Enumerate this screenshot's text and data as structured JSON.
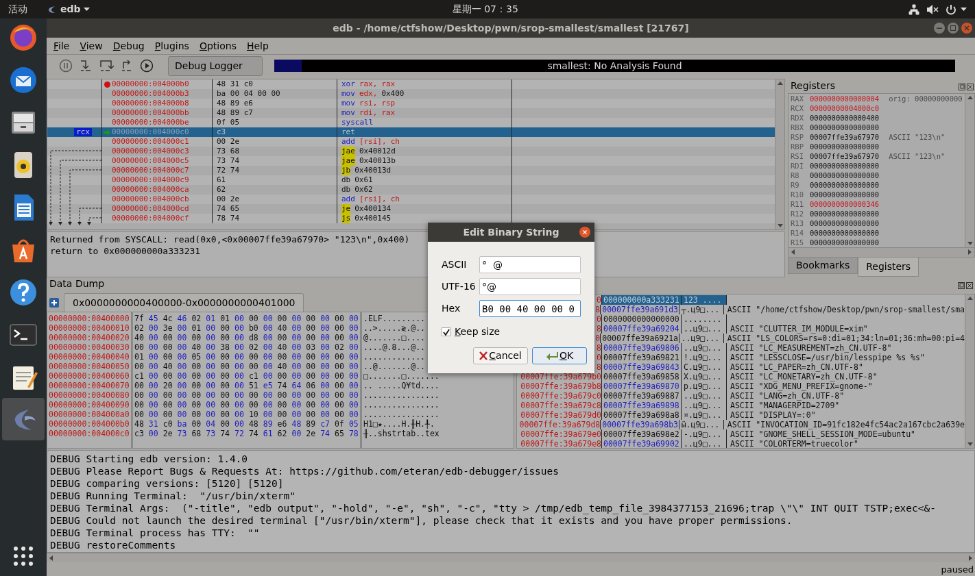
{
  "top_bar": {
    "activities": "活动",
    "app_name": "edb",
    "clock": "星期一 07：35"
  },
  "window": {
    "title": "edb - /home/ctfshow/Desktop/pwn/srop-smallest/smallest [21767]"
  },
  "menu": [
    "File",
    "View",
    "Debug",
    "Plugins",
    "Options",
    "Help"
  ],
  "toolbar": {
    "logger_button": "Debug Logger",
    "analysis": {
      "label": "smallest: No Analysis Found",
      "level": 0.04
    }
  },
  "disassembly": [
    {
      "address": "00000000:004000b0",
      "bytes": "48 31 c0",
      "mnemonic": "xor",
      "kind": "instruction",
      "operands": [
        {
          "text": "rax,",
          "kind": "register"
        },
        {
          "text": "rax",
          "kind": "register"
        }
      ],
      "breakpoint": true,
      "selected": false
    },
    {
      "address": "00000000:004000b3",
      "bytes": "ba 00 04 00 00",
      "mnemonic": "mov",
      "kind": "instruction",
      "operands": [
        {
          "text": "edx,",
          "kind": "register"
        },
        {
          "text": "0x400",
          "kind": "number"
        }
      ],
      "breakpoint": false,
      "selected": false
    },
    {
      "address": "00000000:004000b8",
      "bytes": "48 89 e6",
      "mnemonic": "mov",
      "kind": "instruction",
      "operands": [
        {
          "text": "rsi,",
          "kind": "register"
        },
        {
          "text": "rsp",
          "kind": "register"
        }
      ],
      "breakpoint": false,
      "selected": false
    },
    {
      "address": "00000000:004000bb",
      "bytes": "48 89 c7",
      "mnemonic": "mov",
      "kind": "instruction",
      "operands": [
        {
          "text": "rdi,",
          "kind": "register"
        },
        {
          "text": "rax",
          "kind": "register"
        }
      ],
      "breakpoint": false,
      "selected": false
    },
    {
      "address": "00000000:004000be",
      "bytes": "0f 05",
      "mnemonic": "syscall",
      "kind": "instruction",
      "breakpoint": false,
      "selected": false
    },
    {
      "address": "00000000:004000c0",
      "bytes": "c3",
      "mnemonic": "ret",
      "kind": "instruction",
      "breakpoint": false,
      "selected": true,
      "register_label": "rcx"
    },
    {
      "address": "00000000:004000c1",
      "bytes": "00 2e",
      "mnemonic": "add",
      "kind": "instruction",
      "operands": [
        {
          "text": "[rsi],",
          "kind": "register"
        },
        {
          "text": "ch",
          "kind": "register"
        }
      ],
      "breakpoint": false,
      "selected": false
    },
    {
      "address": "00000000:004000c3",
      "bytes": "73 68",
      "mnemonic": "jae",
      "kind": "jump",
      "operands": [
        {
          "text": "0x40012d",
          "kind": "number"
        }
      ],
      "breakpoint": false,
      "selected": false
    },
    {
      "address": "00000000:004000c5",
      "bytes": "73 74",
      "mnemonic": "jae",
      "kind": "jump",
      "operands": [
        {
          "text": "0x40013b",
          "kind": "number"
        }
      ],
      "breakpoint": false,
      "selected": false
    },
    {
      "address": "00000000:004000c7",
      "bytes": "72 74",
      "mnemonic": "jb",
      "kind": "jump",
      "operands": [
        {
          "text": "0x40013d",
          "kind": "number"
        }
      ],
      "breakpoint": false,
      "selected": false
    },
    {
      "address": "00000000:004000c9",
      "bytes": "61",
      "mnemonic": "db",
      "kind": "data",
      "operands": [
        {
          "text": "0x61",
          "kind": "number"
        }
      ],
      "breakpoint": false,
      "selected": false
    },
    {
      "address": "00000000:004000ca",
      "bytes": "62",
      "mnemonic": "db",
      "kind": "data",
      "operands": [
        {
          "text": "0x62",
          "kind": "number"
        }
      ],
      "breakpoint": false,
      "selected": false
    },
    {
      "address": "00000000:004000cb",
      "bytes": "00 2e",
      "mnemonic": "add",
      "kind": "instruction",
      "operands": [
        {
          "text": "[rsi],",
          "kind": "register"
        },
        {
          "text": "ch",
          "kind": "register"
        }
      ],
      "breakpoint": false,
      "selected": false
    },
    {
      "address": "00000000:004000cd",
      "bytes": "74 65",
      "mnemonic": "je",
      "kind": "jump",
      "operands": [
        {
          "text": "0x400134",
          "kind": "number"
        }
      ],
      "breakpoint": false,
      "selected": false
    },
    {
      "address": "00000000:004000cf",
      "bytes": "78 74",
      "mnemonic": "js",
      "kind": "jump",
      "operands": [
        {
          "text": "0x400145",
          "kind": "number"
        }
      ],
      "breakpoint": false,
      "selected": false
    }
  ],
  "output": [
    "Returned from SYSCALL: read(0x0,<0x00007ffe39a67970> \"123\\n\",0x400)",
    "return to 0x000000000a333231"
  ],
  "registers": {
    "title": "Registers",
    "rows": [
      {
        "name": "RAX",
        "value": "0000000000000004",
        "changed": true,
        "comment": "orig: 00000000000"
      },
      {
        "name": "RCX",
        "value": "00000000004000c0",
        "changed": true
      },
      {
        "name": "RDX",
        "value": "0000000000000400",
        "changed": false
      },
      {
        "name": "RBX",
        "value": "0000000000000000",
        "changed": false
      },
      {
        "name": "RSP",
        "value": "00007ffe39a67970",
        "changed": false,
        "comment": "ASCII \"123\\n\""
      },
      {
        "name": "RBP",
        "value": "0000000000000000",
        "changed": false
      },
      {
        "name": "RSI",
        "value": "00007ffe39a67970",
        "changed": false,
        "comment": "ASCII \"123\\n\""
      },
      {
        "name": "RDI",
        "value": "0000000000000000",
        "changed": false
      },
      {
        "name": "R8",
        "value": "0000000000000000",
        "changed": false
      },
      {
        "name": "R9",
        "value": "0000000000000000",
        "changed": false
      },
      {
        "name": "R10",
        "value": "0000000000000000",
        "changed": false
      },
      {
        "name": "R11",
        "value": "0000000000000346",
        "changed": true
      },
      {
        "name": "R12",
        "value": "0000000000000000",
        "changed": false
      },
      {
        "name": "R13",
        "value": "0000000000000000",
        "changed": false
      },
      {
        "name": "R14",
        "value": "0000000000000000",
        "changed": false
      },
      {
        "name": "R15",
        "value": "0000000000000000",
        "changed": false
      }
    ],
    "tabs": [
      {
        "label": "Bookmarks",
        "selected": false
      },
      {
        "label": "Registers",
        "selected": true
      }
    ]
  },
  "data_dump": {
    "title": "Data Dump",
    "tab": "0x0000000000400000-0x0000000000401000",
    "rows": [
      {
        "address": "00000000:00400000",
        "bytes": [
          "7f",
          "45",
          "4c",
          "46",
          "02",
          "01",
          "01",
          "00",
          "00",
          "00",
          "00",
          "00",
          "00",
          "00",
          "00",
          "00"
        ],
        "ascii": ".ELF........."
      },
      {
        "address": "00000000:00400010",
        "bytes": [
          "02",
          "00",
          "3e",
          "00",
          "01",
          "00",
          "00",
          "00",
          "b0",
          "00",
          "40",
          "00",
          "00",
          "00",
          "00",
          "00"
        ],
        "ascii": "..>.....≷.@.."
      },
      {
        "address": "00000000:00400020",
        "bytes": [
          "40",
          "00",
          "00",
          "00",
          "00",
          "00",
          "00",
          "00",
          "d8",
          "00",
          "00",
          "00",
          "00",
          "00",
          "00",
          "00"
        ],
        "ascii": "@.......□...."
      },
      {
        "address": "00000000:00400030",
        "bytes": [
          "00",
          "00",
          "00",
          "00",
          "40",
          "00",
          "38",
          "00",
          "02",
          "00",
          "40",
          "00",
          "03",
          "00",
          "02",
          "00"
        ],
        "ascii": "....@.8...@.."
      },
      {
        "address": "00000000:00400040",
        "bytes": [
          "01",
          "00",
          "00",
          "00",
          "05",
          "00",
          "00",
          "00",
          "00",
          "00",
          "00",
          "00",
          "00",
          "00",
          "00",
          "00"
        ],
        "ascii": "............."
      },
      {
        "address": "00000000:00400050",
        "bytes": [
          "00",
          "00",
          "40",
          "00",
          "00",
          "00",
          "00",
          "00",
          "00",
          "00",
          "40",
          "00",
          "00",
          "00",
          "00",
          "00"
        ],
        "ascii": "..@.......@.."
      },
      {
        "address": "00000000:00400060",
        "bytes": [
          "c1",
          "00",
          "00",
          "00",
          "00",
          "00",
          "00",
          "00",
          "c1",
          "00",
          "00",
          "00",
          "00",
          "00",
          "00",
          "00"
        ],
        "ascii": "□.......□......."
      },
      {
        "address": "00000000:00400070",
        "bytes": [
          "00",
          "00",
          "20",
          "00",
          "00",
          "00",
          "00",
          "00",
          "51",
          "e5",
          "74",
          "64",
          "06",
          "00",
          "00",
          "00"
        ],
        "ascii": ".. .....Q¥td...."
      },
      {
        "address": "00000000:00400080",
        "bytes": [
          "00",
          "00",
          "00",
          "00",
          "00",
          "00",
          "00",
          "00",
          "00",
          "00",
          "00",
          "00",
          "00",
          "00",
          "00",
          "00"
        ],
        "ascii": "................"
      },
      {
        "address": "00000000:00400090",
        "bytes": [
          "00",
          "00",
          "00",
          "00",
          "00",
          "00",
          "00",
          "00",
          "00",
          "00",
          "00",
          "00",
          "00",
          "00",
          "00",
          "00"
        ],
        "ascii": "................"
      },
      {
        "address": "00000000:004000a0",
        "bytes": [
          "00",
          "00",
          "00",
          "00",
          "00",
          "00",
          "00",
          "00",
          "10",
          "00",
          "00",
          "00",
          "00",
          "00",
          "00",
          "00"
        ],
        "ascii": "................"
      },
      {
        "address": "00000000:004000b0",
        "bytes": [
          "48",
          "31",
          "c0",
          "ba",
          "00",
          "04",
          "00",
          "00",
          "48",
          "89",
          "e6",
          "48",
          "89",
          "c7",
          "0f",
          "05"
        ],
        "ascii": "H1□★....H.╫H.╀."
      },
      {
        "address": "00000000:004000c0",
        "bytes": [
          "c3",
          "00",
          "2e",
          "73",
          "68",
          "73",
          "74",
          "72",
          "74",
          "61",
          "62",
          "00",
          "2e",
          "74",
          "65",
          "78"
        ],
        "ascii": "╫..shstrtab..tex"
      }
    ]
  },
  "stack": [
    {
      "address": "0",
      "value": "000000000a333231",
      "ascii": "123 ....",
      "selected": true
    },
    {
      "address": "8",
      "value": "00007ffe39a691d3",
      "ascii": "┬.ц9□...",
      "comment": "ASCII \"/home/ctfshow/Desktop/pwn/srop-smallest/sma",
      "selected": false
    },
    {
      "address": "0",
      "value": "0000000000000000",
      "ascii": "........",
      "selected": false
    },
    {
      "address": "8",
      "value": "00007ffe39a69204",
      "ascii": "..ц9□...",
      "comment": "ASCII \"CLUTTER_IM_MODULE=xim\"",
      "selected": false
    },
    {
      "address": "0",
      "value": "00007ffe39a6921a",
      "ascii": "..ц9□...",
      "comment": "ASCII \"LS_COLORS=rs=0:di=01;34:ln=01;36:mh=00:pi=4",
      "selected": false
    },
    {
      "address": "8",
      "value": "00007ffe39a69806",
      "ascii": "..ц9□...",
      "comment": "ASCII \"LC_MEASUREMENT=zh_CN.UTF-8\"",
      "selected": false
    },
    {
      "address": "0",
      "value": "00007ffe39a69821",
      "ascii": "!.ц9□...",
      "comment": "ASCII \"LESSCLOSE=/usr/bin/lesspipe %s %s\"",
      "selected": false
    },
    {
      "address": "8",
      "value": "00007ffe39a69843",
      "ascii": "C.ц9□...",
      "comment": "ASCII \"LC_PAPER=zh_CN.UTF-8\"",
      "selected": false
    },
    {
      "address": "00007ffe:39a679b0",
      "value": "00007ffe39a69858",
      "ascii": "X.ц9□...",
      "comment": "ASCII \"LC_MONETARY=zh_CN.UTF-8\"",
      "selected": false
    },
    {
      "address": "00007ffe:39a679b8",
      "value": "00007ffe39a69870",
      "ascii": "p.ц9□...",
      "comment": "ASCII \"XDG_MENU_PREFIX=gnome-\"",
      "selected": false
    },
    {
      "address": "00007ffe:39a679c0",
      "value": "00007ffe39a69887",
      "ascii": "..ц9□...",
      "comment": "ASCII \"LANG=zh_CN.UTF-8\"",
      "selected": false
    },
    {
      "address": "00007ffe:39a679c8",
      "value": "00007ffe39a69898",
      "ascii": "..ц9□...",
      "comment": "ASCII \"MANAGERPID=2709\"",
      "selected": false
    },
    {
      "address": "00007ffe:39a679d0",
      "value": "00007ffe39a698a8",
      "ascii": "¤.ц9□...",
      "comment": "ASCII \"DISPLAY=:0\"",
      "selected": false
    },
    {
      "address": "00007ffe:39a679d8",
      "value": "00007ffe39a698b3",
      "ascii": "ӹ.ц9□...",
      "comment": "ASCII \"INVOCATION_ID=91fc182e4fc54ac2a167cbc2a639e",
      "selected": false
    },
    {
      "address": "00007ffe:39a679e0",
      "value": "00007ffe39a698e2",
      "ascii": "-.ц9□...",
      "comment": "ASCII \"GNOME_SHELL_SESSION_MODE=ubuntu\"",
      "selected": false
    },
    {
      "address": "00007ffe:39a679e8",
      "value": "00007ffe39a69902",
      "ascii": "..ц9□...",
      "comment": "ASCII \"COLORTERM=truecolor\"",
      "selected": false
    }
  ],
  "log": [
    "DEBUG Starting edb version: 1.4.0",
    "DEBUG Please Report Bugs & Requests At: https://github.com/eteran/edb-debugger/issues",
    "DEBUG comparing versions: [5120] [5120]",
    "DEBUG Running Terminal:  \"/usr/bin/xterm\"",
    "DEBUG Terminal Args:  (\"-title\", \"edb output\", \"-hold\", \"-e\", \"sh\", \"-c\", \"tty > /tmp/edb_temp_file_3984377153_21696;trap \\\"\\\" INT QUIT TSTP;exec<&-",
    "DEBUG Could not launch the desired terminal [\"/usr/bin/xterm\"], please check that it exists and you have proper permissions.",
    "DEBUG Terminal process has TTY:  \"\"",
    "DEBUG restoreComments"
  ],
  "status": "paused",
  "dialog": {
    "title": "Edit Binary String",
    "fields": [
      {
        "label": "ASCII",
        "value": "°  @",
        "focused": false
      },
      {
        "label": "UTF-16",
        "value": "°@",
        "focused": false
      },
      {
        "label": "Hex",
        "value": "B0 00 40 00 00 0",
        "focused": true
      }
    ],
    "keep_size": {
      "label": "Keep size",
      "checked": true
    },
    "buttons": [
      {
        "label": "Cancel",
        "kind": "cancel"
      },
      {
        "label": "OK",
        "kind": "ok"
      }
    ]
  }
}
